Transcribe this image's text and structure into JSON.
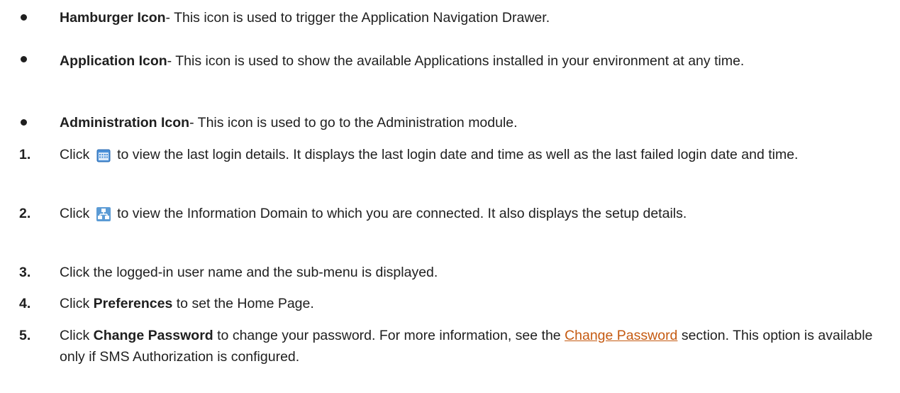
{
  "bullets": [
    {
      "term": "Hamburger Icon",
      "text": "- This icon is used to trigger the Application Navigation Drawer."
    },
    {
      "term": "Application Icon",
      "text": "- This icon is used to show the available Applications installed in your environment at any time."
    },
    {
      "term": "Administration Icon",
      "text": "- This icon is used to go to the Administration module."
    }
  ],
  "steps": [
    {
      "num": "1.",
      "pre": "Click",
      "icon": "calendar-icon",
      "post": "to view the last login details. It displays the last login date and time as well as the last failed login date and time."
    },
    {
      "num": "2.",
      "pre": "Click",
      "icon": "network-icon",
      "post": "to view the Information Domain to which you are connected. It also displays the setup details."
    },
    {
      "num": "3.",
      "pre": "Click the logged-in user name and the sub-menu is displayed."
    },
    {
      "num": "4.",
      "pre": "Click",
      "bold": "Preferences",
      "post": "to set the Home Page."
    },
    {
      "num": "5.",
      "pre": "Click",
      "bold": "Change Password",
      "mid": "to change your password. For more information, see the",
      "link": "Change Password",
      "post": "section. This option is available only if SMS Authorization is configured."
    }
  ],
  "colors": {
    "link": "#c55a11",
    "text": "#1f1f1f",
    "icon_blue": "#4a90d9"
  }
}
